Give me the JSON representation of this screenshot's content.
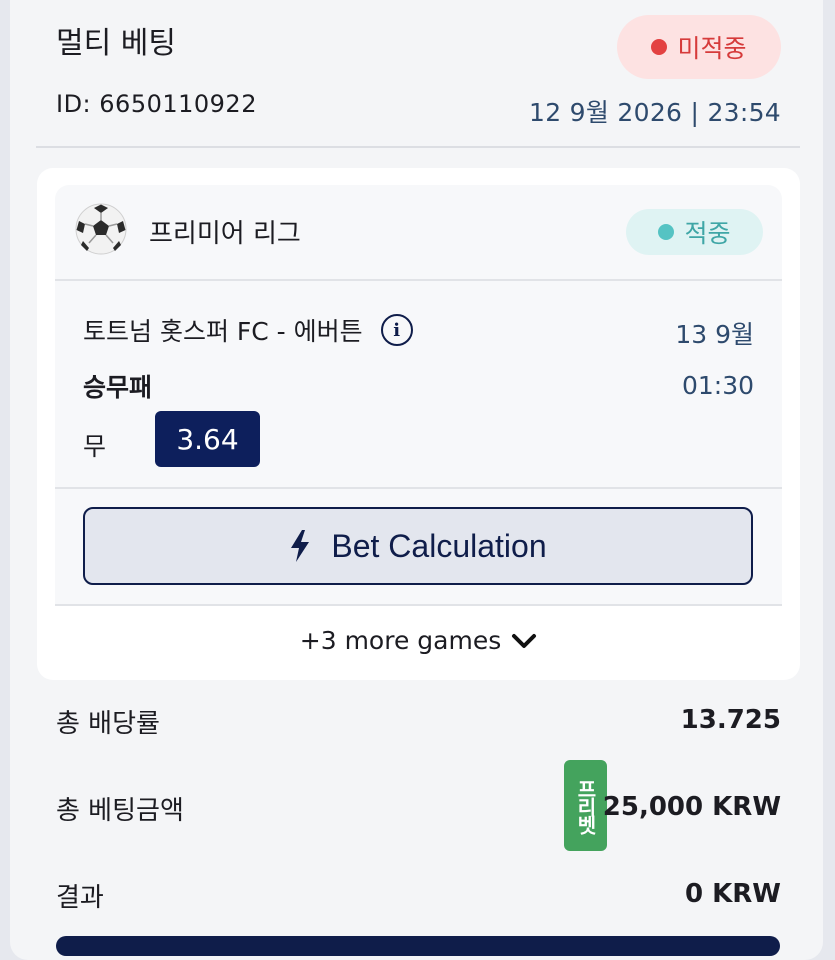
{
  "bet": {
    "title": "멀티 베팅",
    "status": "미적중",
    "status_color": "#e34242",
    "id_text": "ID: 6650110922",
    "datetime": "12 9월 2026 | 23:54"
  },
  "game": {
    "league_icon": "soccer-ball-icon",
    "league": "프리미어 리그",
    "result": "적중",
    "result_color": "#55c3c3",
    "match": "토트넘 홋스퍼 FC - 에버튼",
    "date": "13 9월",
    "market": "승무패",
    "time": "01:30",
    "pick": "무",
    "odds": "3.64",
    "calc_button": "Bet Calculation",
    "calc_icon": "lightning-bolt-icon"
  },
  "more_games": "+3 more games",
  "summary": {
    "total_odds_label": "총 배당률",
    "total_odds": "13.725",
    "stake_label": "총 베팅금액",
    "freebet_badge": "프리벳",
    "stake": "25,000 KRW",
    "result_label": "결과",
    "result": "0 KRW"
  },
  "colors": {
    "navy": "#0d1f5c",
    "freebet": "#44a35d"
  }
}
